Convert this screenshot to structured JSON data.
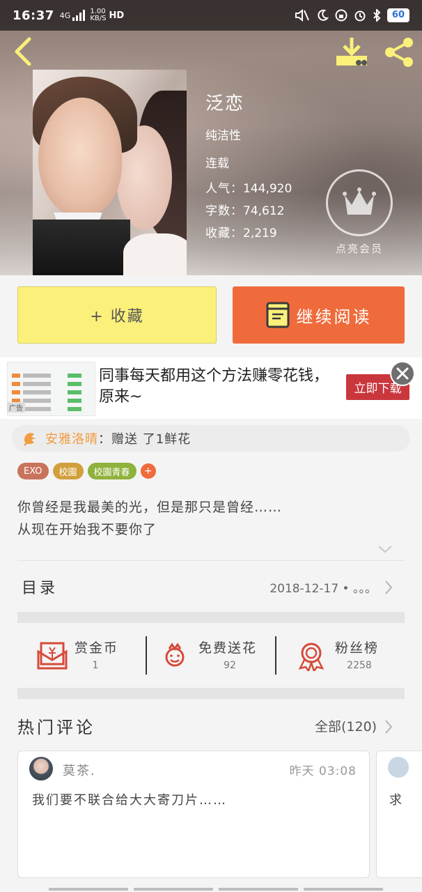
{
  "status_bar": {
    "time": "16:37",
    "net_speed": "1.00\nKB/S",
    "hd": "HD",
    "signal": "4G",
    "battery": "60"
  },
  "book": {
    "title": "泛恋",
    "category": "纯洁性",
    "state": "连载",
    "popularity_label": "人气：",
    "popularity": "144,920",
    "words_label": "字数：",
    "words": "74,612",
    "favorites_label": "收藏：",
    "favorites": "2,219",
    "vip_label": "点亮会员"
  },
  "actions": {
    "favorite": "+ 收藏",
    "continue": "继续阅读"
  },
  "ad": {
    "text": "同事每天都用这个方法赚零花钱，原来~",
    "button": "立即下载",
    "label": "广告"
  },
  "gift": {
    "sender": "安雅洛晴",
    "message": "：赠送 了1鲜花"
  },
  "tags": [
    {
      "label": "EXO",
      "color": "#c8735c"
    },
    {
      "label": "校園",
      "color": "#d1a03c"
    },
    {
      "label": "校園青春",
      "color": "#8fb23c"
    }
  ],
  "description": {
    "line1": "你曾经是我最美的光，但是那只是曾经……",
    "line2": "从现在开始我不要你了"
  },
  "catalog": {
    "title": "目录",
    "date": "2018-12-17 • 。。。"
  },
  "stats": [
    {
      "label": "赏金币",
      "value": "1"
    },
    {
      "label": "免费送花",
      "value": "92"
    },
    {
      "label": "粉丝榜",
      "value": "2258"
    }
  ],
  "comments": {
    "title": "热门评论",
    "all": "全部(120)",
    "items": [
      {
        "user": "莫茶.",
        "time": "昨天 03:08",
        "text": "我们要不联合给大大寄刀片……"
      },
      {
        "text": "求"
      }
    ]
  },
  "colors": {
    "accent_orange": "#ef6b3c",
    "fav_yellow": "#fbf07a",
    "gift_orange": "#f19c3f",
    "ad_red": "#c9373d"
  }
}
